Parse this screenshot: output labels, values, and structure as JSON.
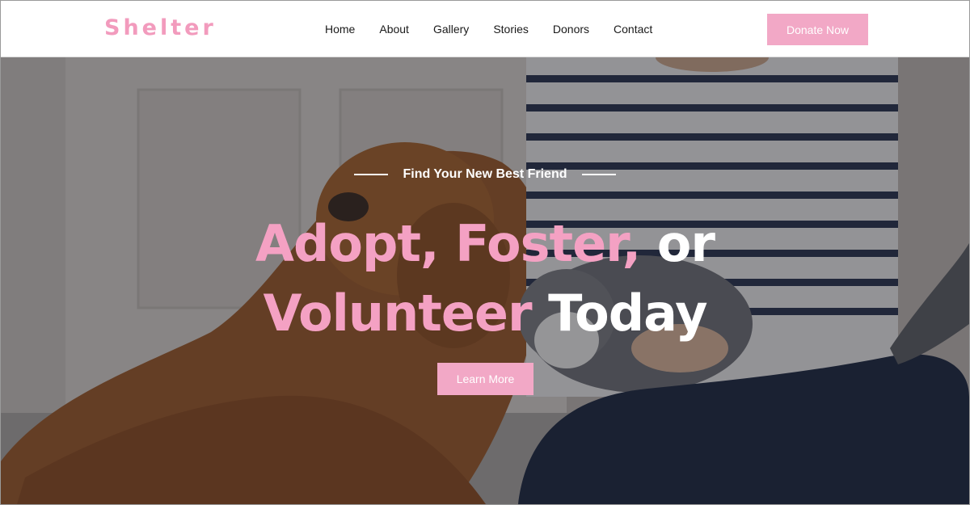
{
  "brand": {
    "logo": "Shelter",
    "accent_color": "#f2a8c6"
  },
  "nav": {
    "items": [
      "Home",
      "About",
      "Gallery",
      "Stories",
      "Donors",
      "Contact"
    ],
    "cta_label": "Donate Now"
  },
  "hero": {
    "image": "hero-photo-dog-cat-person",
    "eyebrow": "Find Your New Best Friend",
    "headline": {
      "line1_pink": "Adopt, Foster,",
      "line1_white": "or",
      "line2_pink": "Volunteer",
      "line2_white": "Today"
    },
    "button_label": "Learn More"
  }
}
